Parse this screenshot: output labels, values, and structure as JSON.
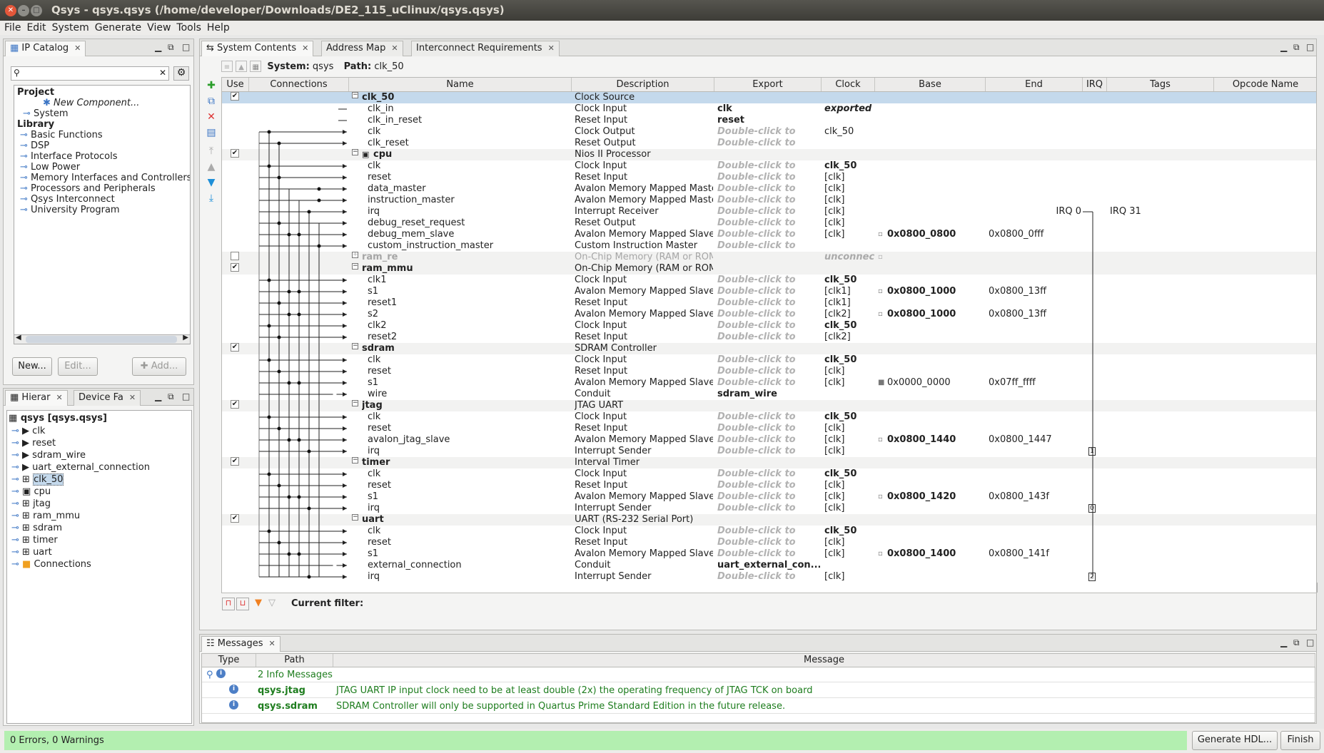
{
  "window": {
    "title": "Qsys - qsys.qsys (/home/developer/Downloads/DE2_115_uClinux/qsys.qsys)"
  },
  "menu": [
    "File",
    "Edit",
    "System",
    "Generate",
    "View",
    "Tools",
    "Help"
  ],
  "ip_catalog": {
    "tab": "IP Catalog",
    "project_label": "Project",
    "project_items": [
      "New Component...",
      "System"
    ],
    "library_label": "Library",
    "library_items": [
      "Basic Functions",
      "DSP",
      "Interface Protocols",
      "Low Power",
      "Memory Interfaces and Controllers",
      "Processors and Peripherals",
      "Qsys Interconnect",
      "University Program"
    ],
    "new_btn": "New...",
    "edit_btn": "Edit...",
    "add_btn": "Add..."
  },
  "hierarchy": {
    "tabs": [
      "Hierar",
      "Device Fa"
    ],
    "root": "qsys [qsys.qsys]",
    "items": [
      "clk",
      "reset",
      "sdram_wire",
      "uart_external_connection",
      "clk_50",
      "cpu",
      "jtag",
      "ram_mmu",
      "sdram",
      "timer",
      "uart",
      "Connections"
    ],
    "selected": "clk_50"
  },
  "system_tabs": [
    "System Contents",
    "Address Map",
    "Interconnect Requirements"
  ],
  "system_path": {
    "system_label": "System:",
    "system": "qsys",
    "path_label": "Path:",
    "path": "clk_50"
  },
  "columns": [
    "Use",
    "Connections",
    "Name",
    "Description",
    "Export",
    "Clock",
    "Base",
    "End",
    "IRQ",
    "Tags",
    "Opcode Name"
  ],
  "rows": [
    {
      "t": "c",
      "name": "clk_50",
      "desc": "Clock Source",
      "use": true,
      "sel": true
    },
    {
      "t": "i",
      "name": "clk_in",
      "desc": "Clock Input",
      "exp": "clk",
      "expb": true,
      "clock": "exported",
      "clki": true
    },
    {
      "t": "i",
      "name": "clk_in_reset",
      "desc": "Reset Input",
      "exp": "reset",
      "expb": true
    },
    {
      "t": "i",
      "name": "clk",
      "desc": "Clock Output",
      "exp": "Double-click to",
      "clock": "clk_50"
    },
    {
      "t": "i",
      "name": "clk_reset",
      "desc": "Reset Output",
      "exp": "Double-click to"
    },
    {
      "t": "c",
      "name": "cpu",
      "desc": "Nios II Processor",
      "use": true
    },
    {
      "t": "i",
      "name": "clk",
      "desc": "Clock Input",
      "exp": "Double-click to",
      "clock": "clk_50",
      "clockb": true
    },
    {
      "t": "i",
      "name": "reset",
      "desc": "Reset Input",
      "exp": "Double-click to",
      "clock": "[clk]"
    },
    {
      "t": "i",
      "name": "data_master",
      "desc": "Avalon Memory Mapped Master",
      "exp": "Double-click to",
      "clock": "[clk]"
    },
    {
      "t": "i",
      "name": "instruction_master",
      "desc": "Avalon Memory Mapped Master",
      "exp": "Double-click to",
      "clock": "[clk]"
    },
    {
      "t": "i",
      "name": "irq",
      "desc": "Interrupt Receiver",
      "exp": "Double-click to",
      "clock": "[clk]",
      "irq": "IRQ 0",
      "irq2": "IRQ 31"
    },
    {
      "t": "i",
      "name": "debug_reset_request",
      "desc": "Reset Output",
      "exp": "Double-click to",
      "clock": "[clk]"
    },
    {
      "t": "i",
      "name": "debug_mem_slave",
      "desc": "Avalon Memory Mapped Slave",
      "exp": "Double-click to",
      "clock": "[clk]",
      "base": "0x0800_0800",
      "end": "0x0800_0fff"
    },
    {
      "t": "i",
      "name": "custom_instruction_master",
      "desc": "Custom Instruction Master",
      "exp": "Double-click to"
    },
    {
      "t": "d",
      "name": "ram_re",
      "desc": "On-Chip Memory (RAM or ROM)",
      "clock": "unconnecte"
    },
    {
      "t": "c",
      "name": "ram_mmu",
      "desc": "On-Chip Memory (RAM or ROM)",
      "use": true
    },
    {
      "t": "i",
      "name": "clk1",
      "desc": "Clock Input",
      "exp": "Double-click to",
      "clock": "clk_50",
      "clockb": true
    },
    {
      "t": "i",
      "name": "s1",
      "desc": "Avalon Memory Mapped Slave",
      "exp": "Double-click to",
      "clock": "[clk1]",
      "base": "0x0800_1000",
      "end": "0x0800_13ff"
    },
    {
      "t": "i",
      "name": "reset1",
      "desc": "Reset Input",
      "exp": "Double-click to",
      "clock": "[clk1]"
    },
    {
      "t": "i",
      "name": "s2",
      "desc": "Avalon Memory Mapped Slave",
      "exp": "Double-click to",
      "clock": "[clk2]",
      "base": "0x0800_1000",
      "end": "0x0800_13ff"
    },
    {
      "t": "i",
      "name": "clk2",
      "desc": "Clock Input",
      "exp": "Double-click to",
      "clock": "clk_50",
      "clockb": true
    },
    {
      "t": "i",
      "name": "reset2",
      "desc": "Reset Input",
      "exp": "Double-click to",
      "clock": "[clk2]"
    },
    {
      "t": "c",
      "name": "sdram",
      "desc": "SDRAM Controller",
      "use": true
    },
    {
      "t": "i",
      "name": "clk",
      "desc": "Clock Input",
      "exp": "Double-click to",
      "clock": "clk_50",
      "clockb": true
    },
    {
      "t": "i",
      "name": "reset",
      "desc": "Reset Input",
      "exp": "Double-click to",
      "clock": "[clk]"
    },
    {
      "t": "i",
      "name": "s1",
      "desc": "Avalon Memory Mapped Slave",
      "exp": "Double-click to",
      "clock": "[clk]",
      "base": "0x0000_0000",
      "end": "0x07ff_ffff",
      "basen": true
    },
    {
      "t": "i",
      "name": "wire",
      "desc": "Conduit",
      "exp": "sdram_wire",
      "expb": true
    },
    {
      "t": "c",
      "name": "jtag",
      "desc": "JTAG UART",
      "use": true
    },
    {
      "t": "i",
      "name": "clk",
      "desc": "Clock Input",
      "exp": "Double-click to",
      "clock": "clk_50",
      "clockb": true
    },
    {
      "t": "i",
      "name": "reset",
      "desc": "Reset Input",
      "exp": "Double-click to",
      "clock": "[clk]"
    },
    {
      "t": "i",
      "name": "avalon_jtag_slave",
      "desc": "Avalon Memory Mapped Slave",
      "exp": "Double-click to",
      "clock": "[clk]",
      "base": "0x0800_1440",
      "end": "0x0800_1447"
    },
    {
      "t": "i",
      "name": "irq",
      "desc": "Interrupt Sender",
      "exp": "Double-click to",
      "clock": "[clk]",
      "irqn": "1"
    },
    {
      "t": "c",
      "name": "timer",
      "desc": "Interval Timer",
      "use": true
    },
    {
      "t": "i",
      "name": "clk",
      "desc": "Clock Input",
      "exp": "Double-click to",
      "clock": "clk_50",
      "clockb": true
    },
    {
      "t": "i",
      "name": "reset",
      "desc": "Reset Input",
      "exp": "Double-click to",
      "clock": "[clk]"
    },
    {
      "t": "i",
      "name": "s1",
      "desc": "Avalon Memory Mapped Slave",
      "exp": "Double-click to",
      "clock": "[clk]",
      "base": "0x0800_1420",
      "end": "0x0800_143f"
    },
    {
      "t": "i",
      "name": "irq",
      "desc": "Interrupt Sender",
      "exp": "Double-click to",
      "clock": "[clk]",
      "irqn": "0"
    },
    {
      "t": "c",
      "name": "uart",
      "desc": "UART (RS-232 Serial Port)",
      "use": true
    },
    {
      "t": "i",
      "name": "clk",
      "desc": "Clock Input",
      "exp": "Double-click to",
      "clock": "clk_50",
      "clockb": true
    },
    {
      "t": "i",
      "name": "reset",
      "desc": "Reset Input",
      "exp": "Double-click to",
      "clock": "[clk]"
    },
    {
      "t": "i",
      "name": "s1",
      "desc": "Avalon Memory Mapped Slave",
      "exp": "Double-click to",
      "clock": "[clk]",
      "base": "0x0800_1400",
      "end": "0x0800_141f"
    },
    {
      "t": "i",
      "name": "external_connection",
      "desc": "Conduit",
      "exp": "uart_external_con...",
      "expb": true
    },
    {
      "t": "i",
      "name": "irq",
      "desc": "Interrupt Sender",
      "exp": "Double-click to",
      "clock": "[clk]",
      "irqn": "2"
    }
  ],
  "filter": {
    "label": "Current filter:"
  },
  "messages": {
    "tab": "Messages",
    "columns": [
      "Type",
      "Path",
      "Message"
    ],
    "summary": "2 Info Messages",
    "items": [
      {
        "path": "qsys.jtag",
        "msg": "JTAG UART IP input clock need to be at least double (2x) the operating frequency of JTAG TCK on board"
      },
      {
        "path": "qsys.sdram",
        "msg": "SDRAM Controller will only be supported in Quartus Prime Standard Edition in the future release."
      }
    ]
  },
  "status": {
    "text": "0 Errors, 0 Warnings",
    "generate": "Generate HDL...",
    "finish": "Finish"
  }
}
